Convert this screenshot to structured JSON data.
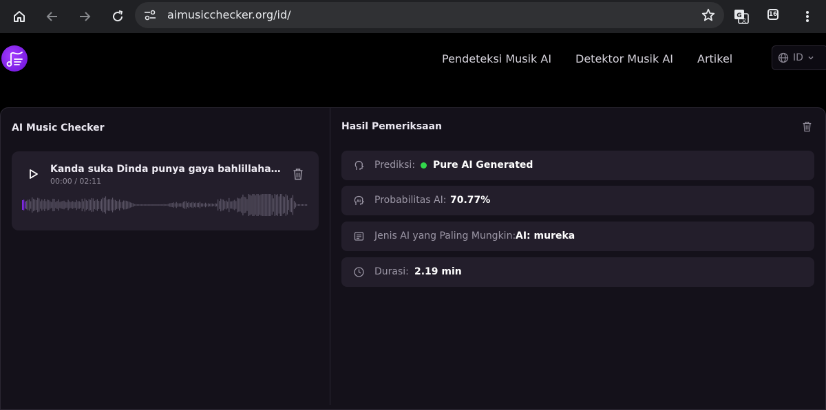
{
  "browser": {
    "url": "aimusicchecker.org/id/",
    "tab_count": "16",
    "icons": [
      "home-icon",
      "back-arrow-icon",
      "forward-arrow-icon",
      "reload-icon",
      "site-settings-icon",
      "bookmark-star-icon",
      "translate-icon",
      "tab-count-icon",
      "more-menu-icon"
    ]
  },
  "header": {
    "nav": [
      "Pendeteksi Musik AI",
      "Detektor Musik AI",
      "Artikel"
    ],
    "language": "ID"
  },
  "checker": {
    "title": "AI Music Checker",
    "track": {
      "title": "Kanda suka Dinda punya gaya bahlillahadalia me...",
      "time": "00:00 / 02:11",
      "progress": 0
    }
  },
  "results": {
    "title": "Hasil Pemeriksaan",
    "rows": [
      {
        "label": "Prediksi:",
        "value": "Pure AI Generated",
        "icon": "prediction-icon"
      },
      {
        "label": "Probabilitas AI:",
        "value": "70.77%",
        "icon": "ai-face-icon"
      },
      {
        "label": "Jenis AI yang Paling Mungkin:",
        "value": "AI: mureka",
        "icon": "list-icon"
      },
      {
        "label": "Durasi:",
        "value": "2.19 min",
        "icon": "clock-icon"
      }
    ]
  },
  "colors": {
    "accent": "#8b2cff",
    "status_green": "#32d74b",
    "panel_bg": "#14111a",
    "card_bg": "#231e2b"
  }
}
